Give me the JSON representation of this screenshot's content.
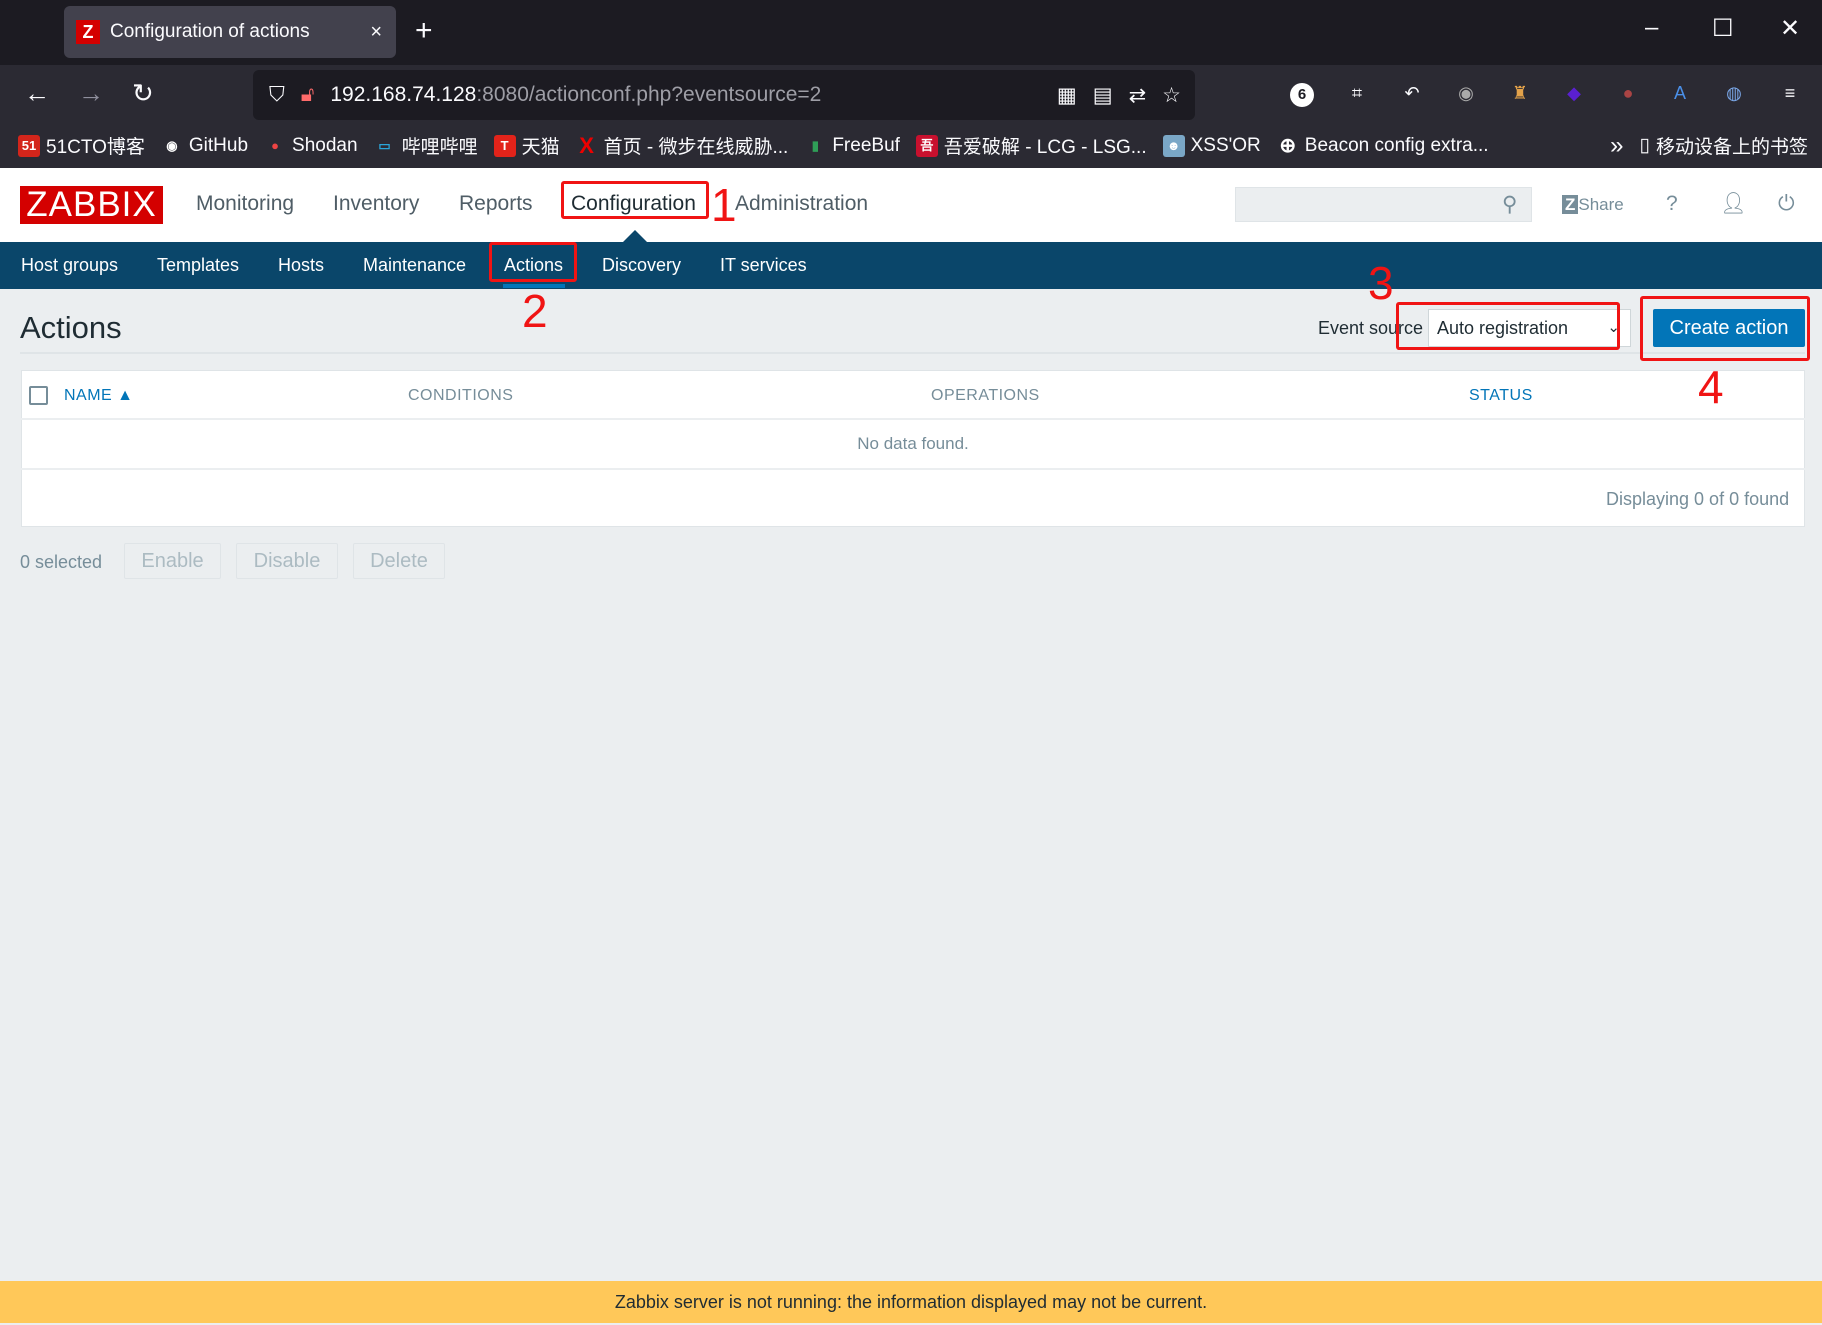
{
  "browser": {
    "tab_title": "Configuration of actions",
    "tab_favicon": "Z",
    "tab_close": "×",
    "new_tab": "+",
    "url_host": "192.168.74.128",
    "url_rest": ":8080/actionconf.php?eventsource=2",
    "extension_badge": "6",
    "bookmarks": [
      {
        "label": "51CTO博客",
        "icon": "51",
        "color": "#d3251b"
      },
      {
        "label": "GitHub",
        "icon": "◉",
        "color": "#2b2a33"
      },
      {
        "label": "Shodan",
        "icon": "●",
        "color": "#b80000"
      },
      {
        "label": "哔哩哔哩",
        "icon": "▭",
        "color": "#2aa5d9"
      },
      {
        "label": "天猫",
        "icon": "T",
        "color": "#e2231a"
      },
      {
        "label": "首页 - 微步在线威胁...",
        "icon": "X",
        "color": "#d00"
      },
      {
        "label": "FreeBuf",
        "icon": "▮",
        "color": "#2f9e57"
      },
      {
        "label": "吾爱破解 - LCG - LSG...",
        "icon": "吾",
        "color": "#c8102e"
      },
      {
        "label": "XSS'OR",
        "icon": "☻",
        "color": "#7aa7c7"
      },
      {
        "label": "Beacon config extra...",
        "icon": "⊕",
        "color": "#2b2a33"
      }
    ],
    "bookmarks_overflow": "»",
    "mobile_bookmarks": "移动设备上的书签"
  },
  "header": {
    "logo": "ZABBIX",
    "menu": [
      "Monitoring",
      "Inventory",
      "Reports",
      "Configuration",
      "Administration"
    ],
    "active_menu": "Configuration",
    "share": "Share",
    "help": "?"
  },
  "subnav": {
    "items": [
      "Host groups",
      "Templates",
      "Hosts",
      "Maintenance",
      "Actions",
      "Discovery",
      "IT services"
    ],
    "active": "Actions"
  },
  "page": {
    "title": "Actions",
    "event_source_label": "Event source",
    "event_source_value": "Auto registration",
    "create_button": "Create action"
  },
  "table": {
    "columns": [
      "NAME ▲",
      "CONDITIONS",
      "OPERATIONS",
      "STATUS"
    ],
    "empty": "No data found.",
    "footer": "Displaying 0 of 0 found"
  },
  "bulk": {
    "selected": "0 selected",
    "buttons": [
      "Enable",
      "Disable",
      "Delete"
    ]
  },
  "warning": "Zabbix server is not running: the information displayed may not be current.",
  "annotations": [
    "1",
    "2",
    "3",
    "4"
  ],
  "colors": {
    "brand": "#d40000",
    "subnav": "#0a466a",
    "primary": "#0275b8",
    "warning": "#ffc859",
    "annotation": "#f01414"
  }
}
